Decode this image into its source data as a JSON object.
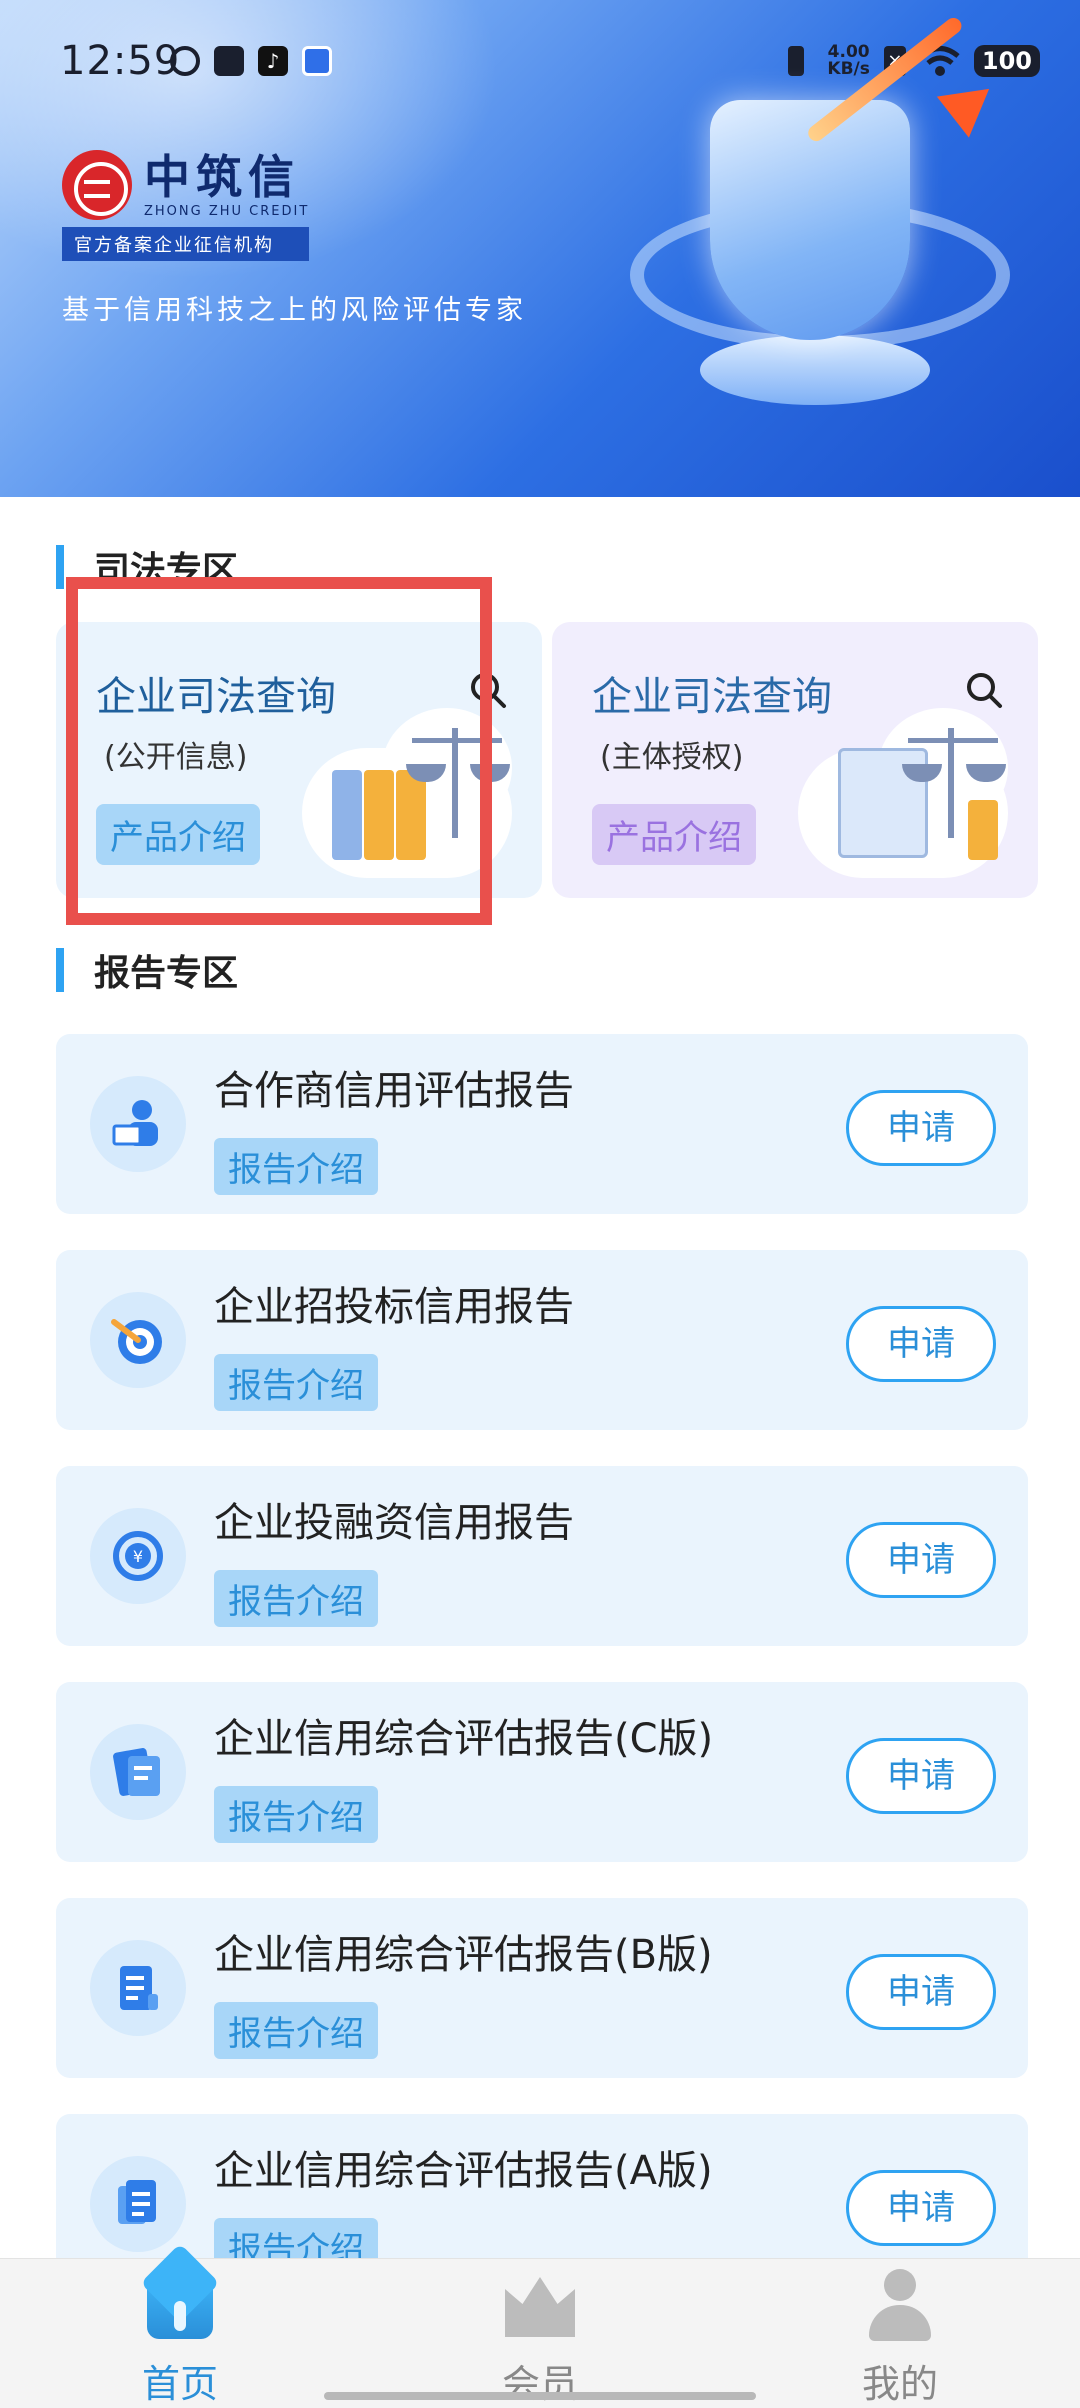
{
  "status_bar": {
    "time": "12:59",
    "net_speed": "4.00",
    "net_unit": "KB/s",
    "battery": "100",
    "icons": [
      "vibrate-icon",
      "wifi-icon",
      "x-icon"
    ]
  },
  "banner": {
    "logo_cn": "中筑信",
    "logo_en": "ZHONG ZHU CREDIT",
    "logo_tag": "官方备案企业征信机构",
    "slogan": "基于信用科技之上的风险评估专家"
  },
  "judicial": {
    "section_title": "司法专区",
    "cards": [
      {
        "title": "企业司法查询",
        "subtitle": "(公开信息)",
        "button": "产品介绍",
        "icon": "search-icon",
        "tint": "#eaf4fd"
      },
      {
        "title": "企业司法查询",
        "subtitle": "(主体授权)",
        "button": "产品介绍",
        "icon": "search-icon",
        "tint": "#f1eefd"
      }
    ]
  },
  "reports": {
    "section_title": "报告专区",
    "items": [
      {
        "title": "合作商信用评估报告",
        "tag": "报告介绍",
        "button": "申请",
        "icon": "partner-icon"
      },
      {
        "title": "企业招投标信用报告",
        "tag": "报告介绍",
        "button": "申请",
        "icon": "target-icon"
      },
      {
        "title": "企业投融资信用报告",
        "tag": "报告介绍",
        "button": "申请",
        "icon": "yuan-coin-icon"
      },
      {
        "title": "企业信用综合评估报告(C版)",
        "tag": "报告介绍",
        "button": "申请",
        "icon": "document-icon"
      },
      {
        "title": "企业信用综合评估报告(B版)",
        "tag": "报告介绍",
        "button": "申请",
        "icon": "scroll-icon"
      },
      {
        "title": "企业信用综合评估报告(A版)",
        "tag": "报告介绍",
        "button": "申请",
        "icon": "files-icon"
      }
    ]
  },
  "bottom_nav": {
    "items": [
      {
        "label": "首页",
        "icon": "home-icon",
        "active": true
      },
      {
        "label": "会员",
        "icon": "crown-icon",
        "active": false
      },
      {
        "label": "我的",
        "icon": "person-icon",
        "active": false
      }
    ]
  },
  "colors": {
    "accent": "#2ea3f2",
    "highlight": "#e9504c",
    "card_blue": "#eaf4fd",
    "card_purple": "#f1eefd"
  }
}
